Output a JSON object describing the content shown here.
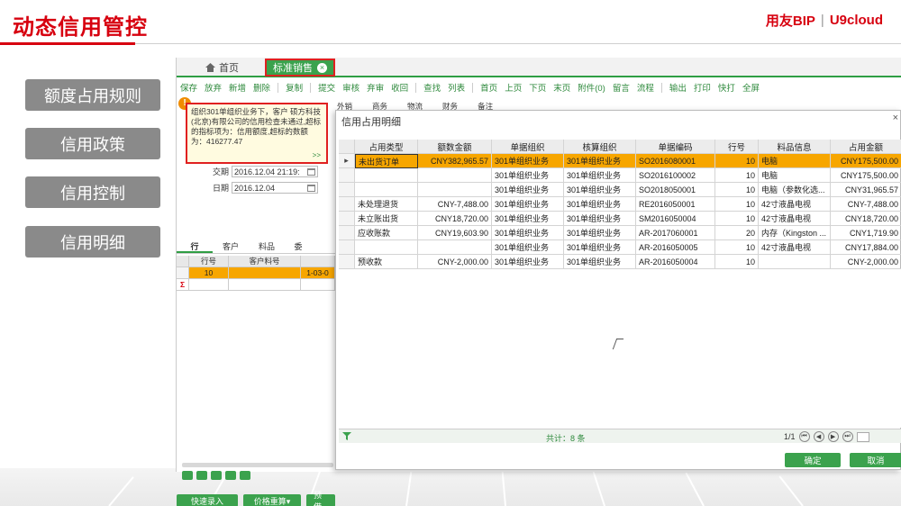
{
  "slide": {
    "title": "动态信用管控"
  },
  "brand": {
    "name": "用友BIP",
    "sep": "|",
    "product": "U9cloud"
  },
  "menu": [
    {
      "label": "额度占用规则"
    },
    {
      "label": "信用政策"
    },
    {
      "label": "信用控制"
    },
    {
      "label": "信用明细"
    }
  ],
  "app": {
    "tabs": {
      "home": "首页",
      "active": "标准销售",
      "close": "×"
    },
    "toolbar": [
      "保存",
      "放弃",
      "新增",
      "删除",
      "|",
      "复制",
      "|",
      "提交",
      "审核",
      "弃审",
      "收回",
      "|",
      "查找",
      "列表",
      "|",
      "首页",
      "上页",
      "下页",
      "末页",
      "附件(0)",
      "留言",
      "流程",
      "|",
      "输出",
      "打印",
      "快打",
      "全屏"
    ],
    "warning": {
      "text": "组织301单组织业务下，客户 硕方科技(北京)有限公司的信用检查未通过,超标的指标项为：信用额度,超标的数额为：416277.47",
      "more": ">>"
    },
    "form": {
      "trade_time_label": "交期",
      "trade_time_value": "2016.12.04 21:19:",
      "date_label": "日期",
      "date_value": "2016.12.04"
    },
    "form_tabs": [
      "外销",
      "商务",
      "物流",
      "财务",
      "备注"
    ],
    "subtabs": [
      "行",
      "客户",
      "料品",
      "委"
    ],
    "left_grid": {
      "headers": [
        "行号",
        "客户料号",
        ""
      ],
      "row": [
        "10",
        "",
        "1-03-0"
      ],
      "sum_symbol": "Σ"
    },
    "bottom_buttons": {
      "quick_entry": "快速录入",
      "price_recalc": "价格重算▾",
      "prepay": "预借"
    }
  },
  "dialog": {
    "title": "信用占用明细",
    "close": "×",
    "headers": [
      "",
      "占用类型",
      "额数金额",
      "单据组织",
      "核算组织",
      "单据编码",
      "行号",
      "料品信息",
      "占用金额"
    ],
    "rows": [
      [
        "▸",
        "未出货订单",
        "CNY382,965.57",
        "301单组织业务",
        "301单组织业务",
        "SO2016080001",
        "10",
        "电脑",
        "CNY175,500.00"
      ],
      [
        "",
        "",
        "",
        "301单组织业务",
        "301单组织业务",
        "SO2016100002",
        "10",
        "电脑",
        "CNY175,500.00"
      ],
      [
        "",
        "",
        "",
        "301单组织业务",
        "301单组织业务",
        "SO2018050001",
        "10",
        "电脑（参数化选...",
        "CNY31,965.57"
      ],
      [
        "",
        "未处理退货",
        "CNY-7,488.00",
        "301单组织业务",
        "301单组织业务",
        "RE2016050001",
        "10",
        "42寸液晶电视",
        "CNY-7,488.00"
      ],
      [
        "",
        "未立账出货",
        "CNY18,720.00",
        "301单组织业务",
        "301单组织业务",
        "SM2016050004",
        "10",
        "42寸液晶电视",
        "CNY18,720.00"
      ],
      [
        "",
        "应收账款",
        "CNY19,603.90",
        "301单组织业务",
        "301单组织业务",
        "AR-2017060001",
        "20",
        "内存（Kingston ...",
        "CNY1,719.90"
      ],
      [
        "",
        "",
        "",
        "301单组织业务",
        "301单组织业务",
        "AR-2016050005",
        "10",
        "42寸液晶电视",
        "CNY17,884.00"
      ],
      [
        "",
        "预收款",
        "CNY-2,000.00",
        "301单组织业务",
        "301单组织业务",
        "AR-2016050004",
        "10",
        "",
        "CNY-2,000.00"
      ]
    ],
    "summary": "共计：8 条",
    "pager": {
      "page": "1/1"
    },
    "ok": "确定",
    "cancel": "取消"
  }
}
